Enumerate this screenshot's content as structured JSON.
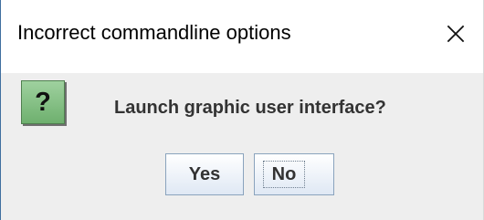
{
  "dialog": {
    "title": "Incorrect commandline options",
    "message": "Launch graphic user interface?",
    "icon": "question-icon",
    "buttons": {
      "yes": "Yes",
      "no": "No"
    },
    "focused_button": "No"
  },
  "window_controls": {
    "close": "×",
    "close_icon": "close-icon"
  },
  "colors": {
    "title_bar": "#ffffff",
    "dialog_body": "#eeeeee",
    "icon_green": "#8fc98f",
    "button_border": "#8aa3bd"
  }
}
